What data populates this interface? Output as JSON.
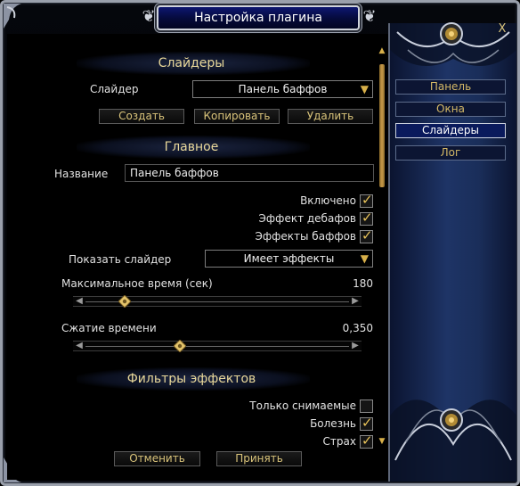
{
  "window": {
    "title": "Настройка плагина",
    "close_label": "X"
  },
  "nav": {
    "items": [
      {
        "label": "Панель",
        "active": false
      },
      {
        "label": "Окна",
        "active": false
      },
      {
        "label": "Слайдеры",
        "active": true
      },
      {
        "label": "Лог",
        "active": false
      }
    ]
  },
  "sliders_section": {
    "title": "Слайдеры",
    "slider_label": "Слайдер",
    "slider_value": "Панель баффов",
    "buttons": {
      "create": "Создать",
      "copy": "Копировать",
      "delete": "Удалить"
    }
  },
  "main_section": {
    "title": "Главное",
    "name_label": "Название",
    "name_value": "Панель баффов",
    "checks": [
      {
        "label": "Включено",
        "checked": true
      },
      {
        "label": "Эффект дебафов",
        "checked": true
      },
      {
        "label": "Эффекты баффов",
        "checked": true
      }
    ],
    "show_slider_label": "Показать слайдер",
    "show_slider_value": "Имеет эффекты",
    "max_time": {
      "label": "Максимальное время (сек)",
      "value": "180",
      "level": 0.13
    },
    "time_compress": {
      "label": "Сжатие времени",
      "value": "0,350",
      "level": 0.35
    }
  },
  "filters_section": {
    "title": "Фильтры эффектов",
    "checks": [
      {
        "label": "Только снимаемые",
        "checked": false
      },
      {
        "label": "Болезнь",
        "checked": true
      },
      {
        "label": "Страх",
        "checked": true
      }
    ]
  },
  "footer": {
    "cancel": "Отменить",
    "apply": "Принять"
  },
  "colors": {
    "accent_gold": "#d9c37a",
    "title_blue": "#0d1670",
    "nav_bg": "#1e3466"
  }
}
